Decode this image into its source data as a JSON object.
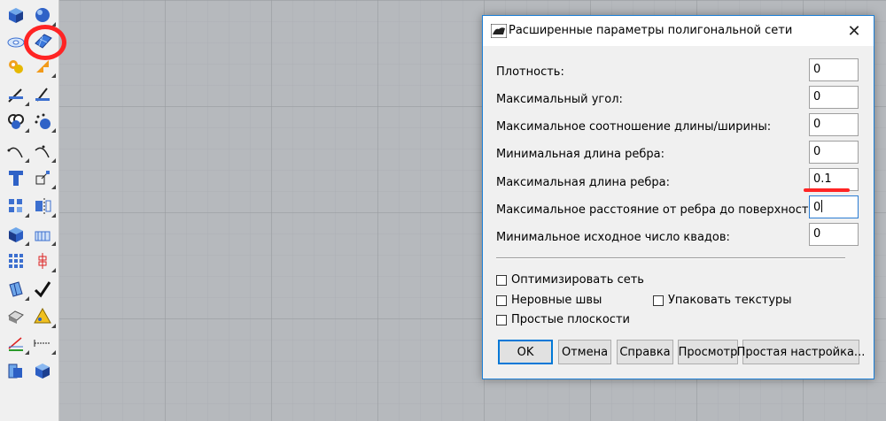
{
  "dialog": {
    "title": "Расширенные параметры полигональной сети",
    "close_symbol": "✕",
    "fields": [
      {
        "label": "Плотность:",
        "value": "0"
      },
      {
        "label": "Максимальный угол:",
        "value": "0"
      },
      {
        "label": "Максимальное соотношение длины/ширины:",
        "value": "0"
      },
      {
        "label": "Минимальная длина ребра:",
        "value": "0"
      },
      {
        "label": "Максимальная длина ребра:",
        "value": "0.1"
      },
      {
        "label": "Максимальное расстояние от ребра до поверхности:",
        "value": "0"
      },
      {
        "label": "Минимальное исходное число квадов:",
        "value": "0"
      }
    ],
    "checkboxes": {
      "optimize": {
        "label": "Оптимизировать сеть",
        "checked": false
      },
      "jagged_seams": {
        "label": "Неровные швы",
        "checked": false
      },
      "pack_textures": {
        "label": "Упаковать текстуры",
        "checked": false
      },
      "simple_planes": {
        "label": "Простые плоскости",
        "checked": false
      }
    },
    "buttons": {
      "ok": "OK",
      "cancel": "Отмена",
      "help": "Справка",
      "preview": "Просмотр",
      "simple_settings": "Простая настройка..."
    }
  },
  "toolbar": {
    "icons": [
      "box-icon",
      "sphere-icon",
      "plane-surface-icon",
      "mesh-icon",
      "gear-puzzle-icon",
      "arrow-orange-icon",
      "split-icon",
      "trim-icon",
      "boolean-icon",
      "points-icon",
      "curve-arc-icon",
      "curve-point-icon",
      "text-icon",
      "scale-icon",
      "array-icon",
      "mirror-icon",
      "solid-box-icon",
      "hatch-icon",
      "grid-array-icon",
      "gumball-icon",
      "analyze-icon",
      "check-icon",
      "shade-icon",
      "pyramid-icon",
      "cplane-icon",
      "dimension-icon",
      "block-icon",
      "render-box-icon"
    ]
  },
  "colors": {
    "accent": "#0078d7",
    "annotation_red": "#ff2424",
    "viewport_bg": "#b6b9bd"
  }
}
